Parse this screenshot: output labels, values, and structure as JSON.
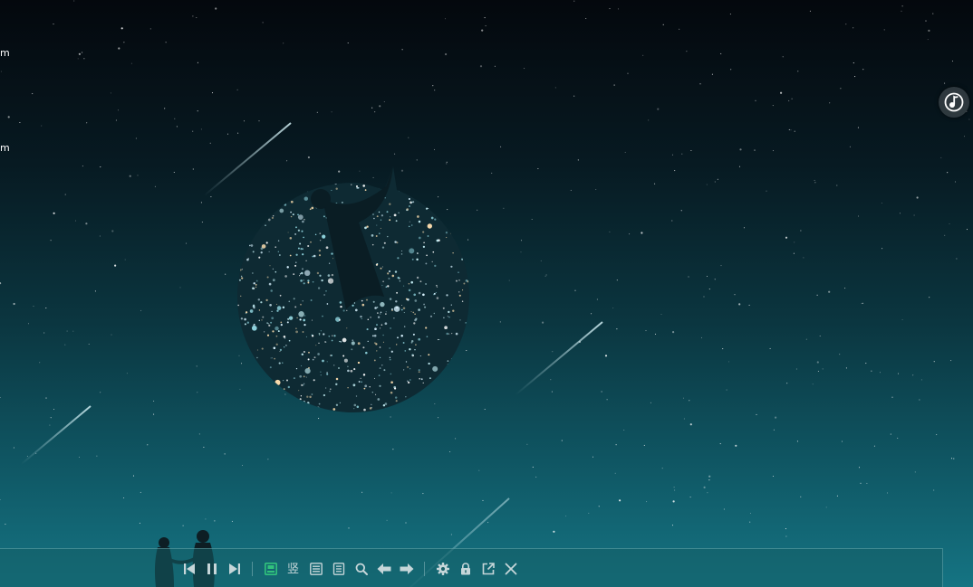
{
  "desktop": {
    "left_labels": [
      "m",
      "m"
    ]
  },
  "floating_icon": {
    "name": "qq-music-floating-icon"
  },
  "lyric_toolbar": {
    "playback": [
      {
        "name": "previous-track",
        "icon": "skip-previous-icon"
      },
      {
        "name": "pause",
        "icon": "pause-icon"
      },
      {
        "name": "next-track",
        "icon": "skip-next-icon"
      }
    ],
    "vertical_mode_label": "竖",
    "tools": [
      {
        "name": "theme",
        "icon": "theme-icon",
        "active": true
      },
      {
        "name": "vertical-lyrics",
        "icon": "vertical-text-icon"
      },
      {
        "name": "karaoke",
        "icon": "karaoke-icon"
      },
      {
        "name": "lyrics-file",
        "icon": "document-icon"
      },
      {
        "name": "search-lyrics",
        "icon": "search-icon"
      },
      {
        "name": "lyrics-backward",
        "icon": "arrow-left-icon"
      },
      {
        "name": "lyrics-forward",
        "icon": "arrow-right-icon"
      },
      {
        "name": "settings",
        "icon": "gear-icon"
      },
      {
        "name": "lock",
        "icon": "lock-icon"
      },
      {
        "name": "open-external",
        "icon": "external-link-icon"
      },
      {
        "name": "close",
        "icon": "close-icon"
      }
    ],
    "colors": {
      "icon": "#c6d6d9",
      "active": "#31c27c"
    }
  }
}
